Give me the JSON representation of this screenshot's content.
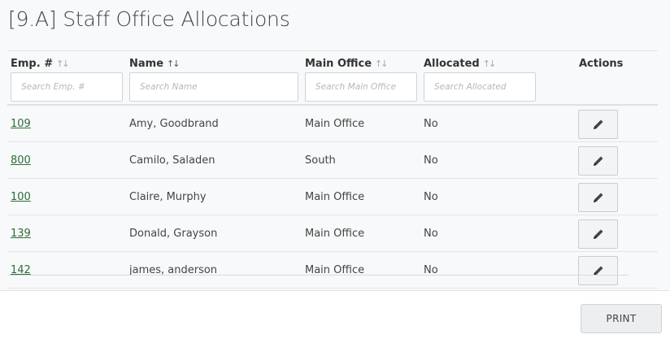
{
  "page": {
    "title": "[9.A] Staff Office Allocations"
  },
  "table": {
    "columns": [
      {
        "label": "Emp. #",
        "sort": "↑↓",
        "placeholder": "Search Emp. #"
      },
      {
        "label": "Name",
        "sort": "↑↓",
        "placeholder": "Search Name"
      },
      {
        "label": "Main Office",
        "sort": "↑↓",
        "placeholder": "Search Main Office"
      },
      {
        "label": "Allocated",
        "sort": "↑↓",
        "placeholder": "Search Allocated"
      },
      {
        "label": "Actions"
      }
    ],
    "rows": [
      {
        "emp": "109",
        "name": "Amy, Goodbrand",
        "office": "Main Office",
        "allocated": "No"
      },
      {
        "emp": "800",
        "name": "Camilo, Saladen",
        "office": "South",
        "allocated": "No"
      },
      {
        "emp": "100",
        "name": "Claire, Murphy",
        "office": "Main Office",
        "allocated": "No"
      },
      {
        "emp": "139",
        "name": "Donald, Grayson",
        "office": "Main Office",
        "allocated": "No"
      },
      {
        "emp": "142",
        "name": "james, anderson",
        "office": "Main Office",
        "allocated": "No"
      }
    ],
    "row_action_icon": "pencil-icon"
  },
  "footer": {
    "print_label": "PRINT"
  },
  "colors": {
    "link": "#2e6b3b",
    "panel_bg": "#f8f9fa"
  }
}
